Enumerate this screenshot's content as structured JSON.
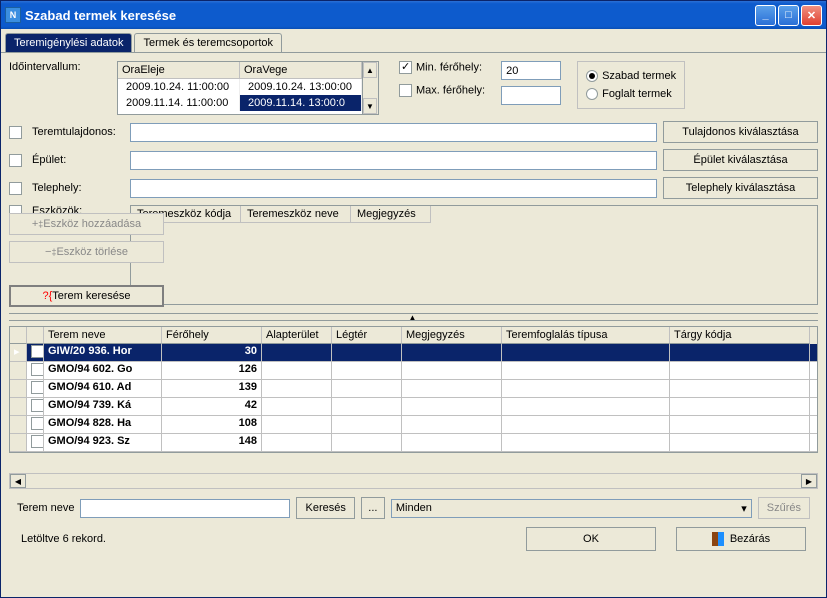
{
  "title": "Szabad termek keresése",
  "tabs": {
    "t1": "Teremigénylési adatok",
    "t2": "Termek és teremcsoportok"
  },
  "labels": {
    "interval": "Időintervallum:",
    "tulajdonos": "Teremtulajdonos:",
    "epulet": "Épület:",
    "telephely": "Telephely:",
    "eszkozok": "Eszközök:",
    "min": "Min. férőhely:",
    "max": "Max. férőhely:",
    "teremneve": "Terem neve"
  },
  "timegrid": {
    "h1": "OraEleje",
    "h2": "OraVege",
    "r1c1": "2009.10.24. 11:00:00",
    "r1c2": "2009.10.24. 13:00:00",
    "r2c1": "2009.11.14. 11:00:00",
    "r2c2": "2009.11.14. 13:00:0"
  },
  "minVal": "20",
  "maxVal": "",
  "radios": {
    "szabad": "Szabad termek",
    "foglalt": "Foglalt termek"
  },
  "buttons": {
    "tulajdonos": "Tulajdonos kiválasztása",
    "epulet": "Épület kiválasztása",
    "telephely": "Telephely kiválasztása",
    "eszkozAdd": "Eszköz hozzáadása",
    "eszkozDel": "Eszköz törlése",
    "keres": "Terem keresése",
    "kereses": "Keresés",
    "dots": "...",
    "szures": "Szűrés",
    "ok": "OK",
    "bezaras": "Bezárás"
  },
  "eszkozcols": {
    "c1": "Teremeszköz kódja",
    "c2": "Teremeszköz neve",
    "c3": "Megjegyzés"
  },
  "dropdown": "Minden",
  "resultcols": {
    "name": "Terem neve",
    "cap": "Férőhely",
    "area": "Alapterület",
    "leg": "Légtér",
    "meg": "Megjegyzés",
    "tip": "Teremfoglalás típusa",
    "targy": "Tárgy kódja"
  },
  "rows": [
    {
      "name": "GIW/20 936. Hor",
      "cap": "30"
    },
    {
      "name": "GMO/94 602. Go",
      "cap": "126"
    },
    {
      "name": "GMO/94 610. Ad",
      "cap": "139"
    },
    {
      "name": "GMO/94 739. Ká",
      "cap": "42"
    },
    {
      "name": "GMO/94 828. Ha",
      "cap": "108"
    },
    {
      "name": "GMO/94 923. Sz",
      "cap": "148"
    }
  ],
  "status": "Letöltve 6 rekord."
}
